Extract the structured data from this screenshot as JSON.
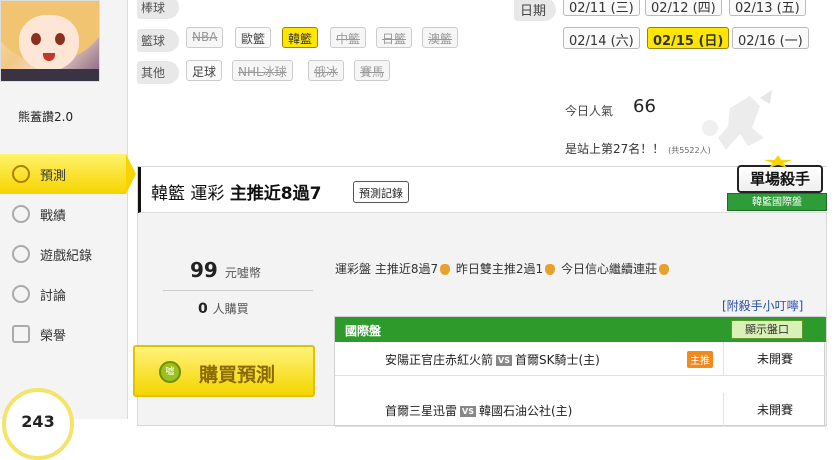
{
  "user": {
    "name": "熊蓋讚2.0"
  },
  "nav": [
    {
      "label": "預測",
      "icon": "target-icon"
    },
    {
      "label": "戰績",
      "icon": "chart-icon"
    },
    {
      "label": "遊戲紀錄",
      "icon": "circle-icon"
    },
    {
      "label": "討論",
      "icon": "chat-icon"
    },
    {
      "label": "榮譽",
      "icon": "trophy-icon"
    }
  ],
  "bottom_counter": "243",
  "filters": {
    "baseball_label": "棒球",
    "basketball_label": "籃球",
    "basketball": [
      "NBA",
      "歐籃",
      "韓籃",
      "中籃",
      "日籃",
      "澳籃"
    ],
    "other_label": "其他",
    "other": [
      "足球",
      "NHL冰球",
      "俄冰",
      "賽馬"
    ]
  },
  "dates": {
    "label": "日期",
    "row1": [
      "02/11 (三)",
      "02/12 (四)",
      "02/13 (五)"
    ],
    "row2": [
      "02/14 (六)",
      "02/15 (日)",
      "02/16 (一)"
    ]
  },
  "popularity": {
    "label": "今日人氣",
    "value": "66"
  },
  "rank": {
    "text": "是站上第27名！！",
    "total": "(共5522人)"
  },
  "panel": {
    "title_pre": "韓籃 運彩 ",
    "title_bold": "主推近8過7",
    "record_button": "預測記錄",
    "badge_main": "單場殺手",
    "badge_sub": "韓籃國際盤"
  },
  "price": {
    "value": "99",
    "unit": "元噓幣"
  },
  "buyers": {
    "value": "0",
    "unit": "人購買"
  },
  "buy_button": "購買預測",
  "coin_icon_text": "噓",
  "description": {
    "part1": "運彩盤 主推近8過7",
    "part2": " 昨日雙主推2過1",
    "part3": " 今日信心繼續連莊"
  },
  "tip_link": "[附殺手小叮嚀]",
  "table": {
    "title": "國際盤",
    "show_button": "顯示盤口",
    "rows": [
      {
        "away": "安陽正官庄赤紅火箭",
        "vs": "VS",
        "home": "首爾SK騎士(主)",
        "pick": "主推",
        "status": "未開賽"
      },
      {
        "away": "首爾三星迅雷",
        "vs": "VS",
        "home": "韓國石油公社(主)",
        "pick": "",
        "status": "未開賽"
      }
    ]
  },
  "colors": {
    "accent_yellow": "#ffe600",
    "table_green": "#2f9a2c",
    "pick_orange": "#f08a1c"
  }
}
